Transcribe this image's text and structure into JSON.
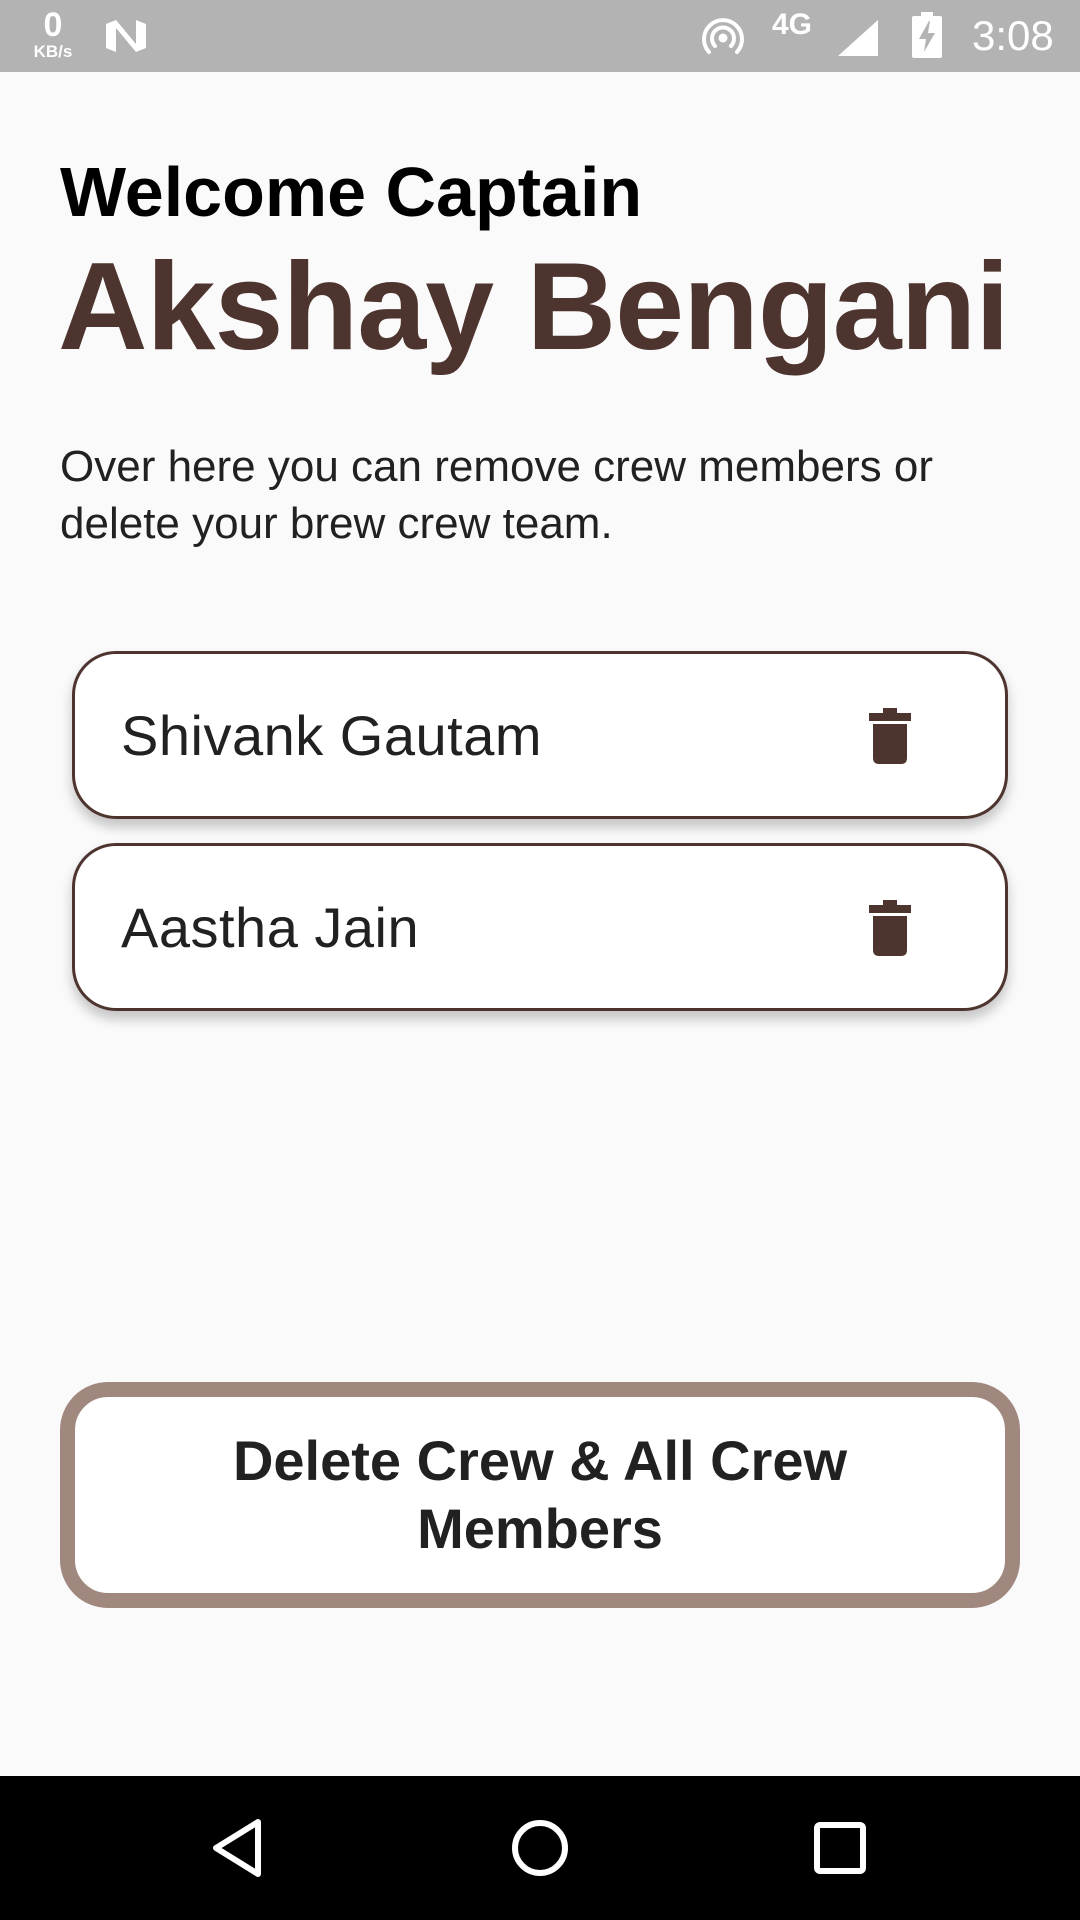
{
  "status_bar": {
    "net_speed_value": "0",
    "net_speed_unit": "KB/s",
    "network_type": "4G",
    "time": "3:08",
    "icons": [
      "n-notification-icon",
      "hotspot-icon",
      "signal-icon",
      "battery-charging-icon"
    ]
  },
  "header": {
    "welcome": "Welcome Captain",
    "captain_name": "Akshay Bengani",
    "description": "Over here you can remove crew members or delete your brew crew team."
  },
  "crew_members": [
    {
      "name": "Shivank Gautam",
      "action_icon": "trash-icon"
    },
    {
      "name": "Aastha Jain",
      "action_icon": "trash-icon"
    }
  ],
  "delete_button": {
    "label": "Delete Crew & All Crew Members"
  },
  "nav_bar": {
    "buttons": [
      "back-icon",
      "home-icon",
      "recents-icon"
    ]
  },
  "colors": {
    "accent": "#4e342e",
    "button_border": "#a1887f",
    "background": "#fafafa",
    "status_bar": "#b3b3b3"
  }
}
